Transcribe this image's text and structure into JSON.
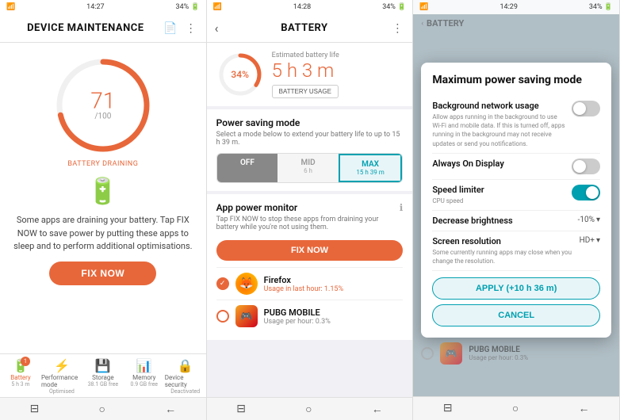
{
  "panel1": {
    "status": {
      "left": "📶 34%",
      "time": "14:27",
      "right": "34% 🔋"
    },
    "title": "DEVICE MAINTENANCE",
    "gauge_value": "71",
    "gauge_max": "/100",
    "gauge_label": "BATTERY DRAINING",
    "description": "Some apps are draining your battery. Tap FIX NOW to save power by putting these apps to sleep and to perform additional optimisations.",
    "fix_btn": "FIX NOW",
    "nav": [
      {
        "id": "battery",
        "icon": "🔋",
        "label": "Battery",
        "sub": "5 h 3 m",
        "badge": "1",
        "active": true
      },
      {
        "id": "performance",
        "icon": "⚡",
        "label": "Performance",
        "sub": "Optimised",
        "active": false
      },
      {
        "id": "storage",
        "icon": "💾",
        "label": "Storage",
        "sub": "38.1 GB free",
        "active": false
      },
      {
        "id": "memory",
        "icon": "📊",
        "label": "Memory",
        "sub": "0.9 GB free",
        "active": false
      },
      {
        "id": "security",
        "icon": "🔒",
        "label": "Device security",
        "sub": "Deactivated",
        "active": false
      }
    ],
    "sys_nav": [
      "⊟",
      "○",
      "←"
    ]
  },
  "panel2": {
    "status": {
      "time": "14:28"
    },
    "title": "BATTERY",
    "battery_pct": "34%",
    "est_label": "Estimated battery life",
    "est_time": "5 h 3 m",
    "usage_btn": "BATTERY USAGE",
    "power_saving": {
      "title": "Power saving mode",
      "sub": "Select a mode below to extend your battery life to up to 15 h 39 m.",
      "options": [
        {
          "id": "off",
          "label": "OFF",
          "sub": "",
          "state": "off"
        },
        {
          "id": "mid",
          "label": "MID",
          "sub": "6 h",
          "state": "mid"
        },
        {
          "id": "max",
          "label": "MAX",
          "sub": "15 h 39 m",
          "state": "max"
        }
      ]
    },
    "app_monitor": {
      "title": "App power monitor",
      "sub": "Tap FIX NOW to stop these apps from draining your battery while you're not using them.",
      "fix_btn": "FIX NOW"
    },
    "apps": [
      {
        "name": "Firefox",
        "usage": "Usage in last hour: 1.15%",
        "checked": true,
        "type": "firefox"
      },
      {
        "name": "PUBG MOBILE",
        "usage": "Usage per hour: 0.3%",
        "checked": false,
        "type": "pubg"
      }
    ],
    "sys_nav": [
      "⊟",
      "○",
      "←"
    ]
  },
  "panel3": {
    "status": {
      "time": "14:29"
    },
    "modal": {
      "title": "Maximum power saving mode",
      "settings": [
        {
          "label": "Background network usage",
          "desc": "Allow apps running in the background to use Wi-Fi and mobile data. If this is turned off, apps running in the background may not receive updates or send you notifications.",
          "type": "toggle",
          "on": false
        },
        {
          "label": "Always On Display",
          "desc": "",
          "type": "toggle",
          "on": false
        },
        {
          "label": "Speed limiter",
          "desc": "CPU speed",
          "type": "toggle",
          "on": true
        },
        {
          "label": "Decrease brightness",
          "desc": "",
          "type": "value",
          "value": "-10%"
        },
        {
          "label": "Screen resolution",
          "desc": "Some currently running apps may close when you change the resolution.",
          "type": "value",
          "value": "HD+"
        }
      ],
      "apply_btn": "APPLY (+10 h 36 m)",
      "cancel_btn": "CANCEL"
    },
    "behind_app": {
      "name": "PUBG MOBILE",
      "usage": "Usage per hour: 0.3%"
    },
    "sys_nav": [
      "⊟",
      "○",
      "←"
    ]
  }
}
